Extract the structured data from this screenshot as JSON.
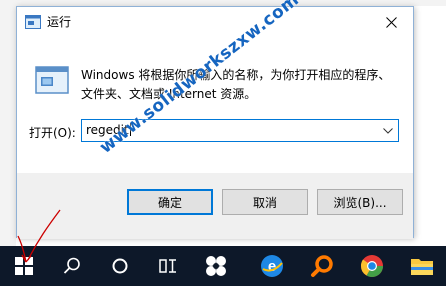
{
  "dialog": {
    "title": "运行",
    "description_line1": "Windows 将根据你所输入的名称，为你打开相应的程序、",
    "description_line2": "文件夹、文档或 Internet 资源。",
    "open_label": "打开(O):",
    "open_value": "regedit",
    "ok_label": "确定",
    "cancel_label": "取消",
    "browse_label": "浏览(B)..."
  },
  "watermark": "www.solidworkszxw.com",
  "taskbar": {
    "items": [
      "start-icon",
      "search-icon",
      "cortana-icon",
      "task-view-icon",
      "pinwheel-app-icon",
      "edge-icon",
      "search-magnifier-app-icon",
      "chrome-icon",
      "file-explorer-icon"
    ]
  },
  "colors": {
    "accent": "#0078d7",
    "taskbar": "#0d1829",
    "watermark": "#1565c0",
    "annotation": "#cc0000"
  }
}
